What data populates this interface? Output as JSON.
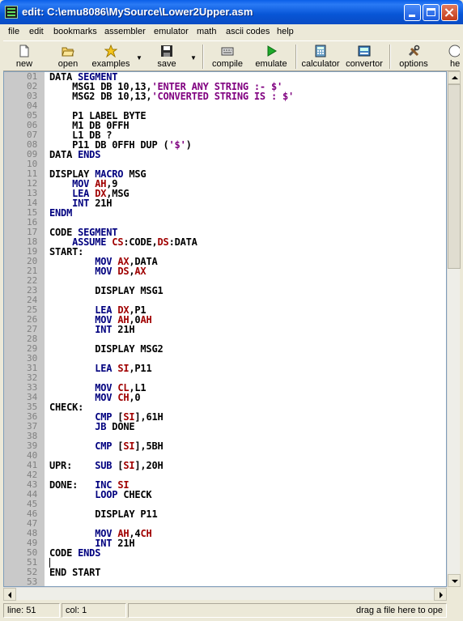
{
  "window": {
    "title": "edit: C:\\emu8086\\MySource\\Lower2Upper.asm"
  },
  "menu": [
    "file",
    "edit",
    "bookmarks",
    "assembler",
    "emulator",
    "math",
    "ascii codes",
    "help"
  ],
  "toolbar": {
    "new": "new",
    "open": "open",
    "examples": "examples",
    "save": "save",
    "compile": "compile",
    "emulate": "emulate",
    "calculator": "calculator",
    "convertor": "convertor",
    "options": "options",
    "help": "he"
  },
  "code": {
    "lines": [
      {
        "n": "01",
        "t": "DATA SEGMENT"
      },
      {
        "n": "02",
        "t": "    MSG1 DB 10,13,'ENTER ANY STRING :- $'"
      },
      {
        "n": "03",
        "t": "    MSG2 DB 10,13,'CONVERTED STRING IS : $'"
      },
      {
        "n": "04",
        "t": ""
      },
      {
        "n": "05",
        "t": "    P1 LABEL BYTE"
      },
      {
        "n": "06",
        "t": "    M1 DB 0FFH"
      },
      {
        "n": "07",
        "t": "    L1 DB ?"
      },
      {
        "n": "08",
        "t": "    P11 DB 0FFH DUP ('$')"
      },
      {
        "n": "09",
        "t": "DATA ENDS"
      },
      {
        "n": "10",
        "t": ""
      },
      {
        "n": "11",
        "t": "DISPLAY MACRO MSG"
      },
      {
        "n": "12",
        "t": "    MOV AH,9"
      },
      {
        "n": "13",
        "t": "    LEA DX,MSG"
      },
      {
        "n": "14",
        "t": "    INT 21H"
      },
      {
        "n": "15",
        "t": "ENDM"
      },
      {
        "n": "16",
        "t": ""
      },
      {
        "n": "17",
        "t": "CODE SEGMENT"
      },
      {
        "n": "18",
        "t": "    ASSUME CS:CODE,DS:DATA"
      },
      {
        "n": "19",
        "t": "START:"
      },
      {
        "n": "20",
        "t": "        MOV AX,DATA"
      },
      {
        "n": "21",
        "t": "        MOV DS,AX"
      },
      {
        "n": "22",
        "t": ""
      },
      {
        "n": "23",
        "t": "        DISPLAY MSG1"
      },
      {
        "n": "24",
        "t": ""
      },
      {
        "n": "25",
        "t": "        LEA DX,P1"
      },
      {
        "n": "26",
        "t": "        MOV AH,0AH"
      },
      {
        "n": "27",
        "t": "        INT 21H"
      },
      {
        "n": "28",
        "t": ""
      },
      {
        "n": "29",
        "t": "        DISPLAY MSG2"
      },
      {
        "n": "30",
        "t": ""
      },
      {
        "n": "31",
        "t": "        LEA SI,P11"
      },
      {
        "n": "32",
        "t": ""
      },
      {
        "n": "33",
        "t": "        MOV CL,L1"
      },
      {
        "n": "34",
        "t": "        MOV CH,0"
      },
      {
        "n": "35",
        "t": "CHECK:"
      },
      {
        "n": "36",
        "t": "        CMP [SI],61H"
      },
      {
        "n": "37",
        "t": "        JB DONE"
      },
      {
        "n": "38",
        "t": ""
      },
      {
        "n": "39",
        "t": "        CMP [SI],5BH"
      },
      {
        "n": "40",
        "t": ""
      },
      {
        "n": "41",
        "t": "UPR:    SUB [SI],20H"
      },
      {
        "n": "42",
        "t": ""
      },
      {
        "n": "43",
        "t": "DONE:   INC SI"
      },
      {
        "n": "44",
        "t": "        LOOP CHECK"
      },
      {
        "n": "45",
        "t": ""
      },
      {
        "n": "46",
        "t": "        DISPLAY P11"
      },
      {
        "n": "47",
        "t": ""
      },
      {
        "n": "48",
        "t": "        MOV AH,4CH"
      },
      {
        "n": "49",
        "t": "        INT 21H"
      },
      {
        "n": "50",
        "t": "CODE ENDS"
      },
      {
        "n": "51",
        "t": ""
      },
      {
        "n": "52",
        "t": "END START"
      },
      {
        "n": "53",
        "t": ""
      }
    ],
    "caret_line": "51"
  },
  "status": {
    "line": "line: 51",
    "col": "col: 1",
    "hint": "drag a file here to ope"
  },
  "colors": {
    "keyword": "#00007f",
    "register": "#a00000",
    "string": "#800080",
    "gutter": "#c9c9c9"
  }
}
